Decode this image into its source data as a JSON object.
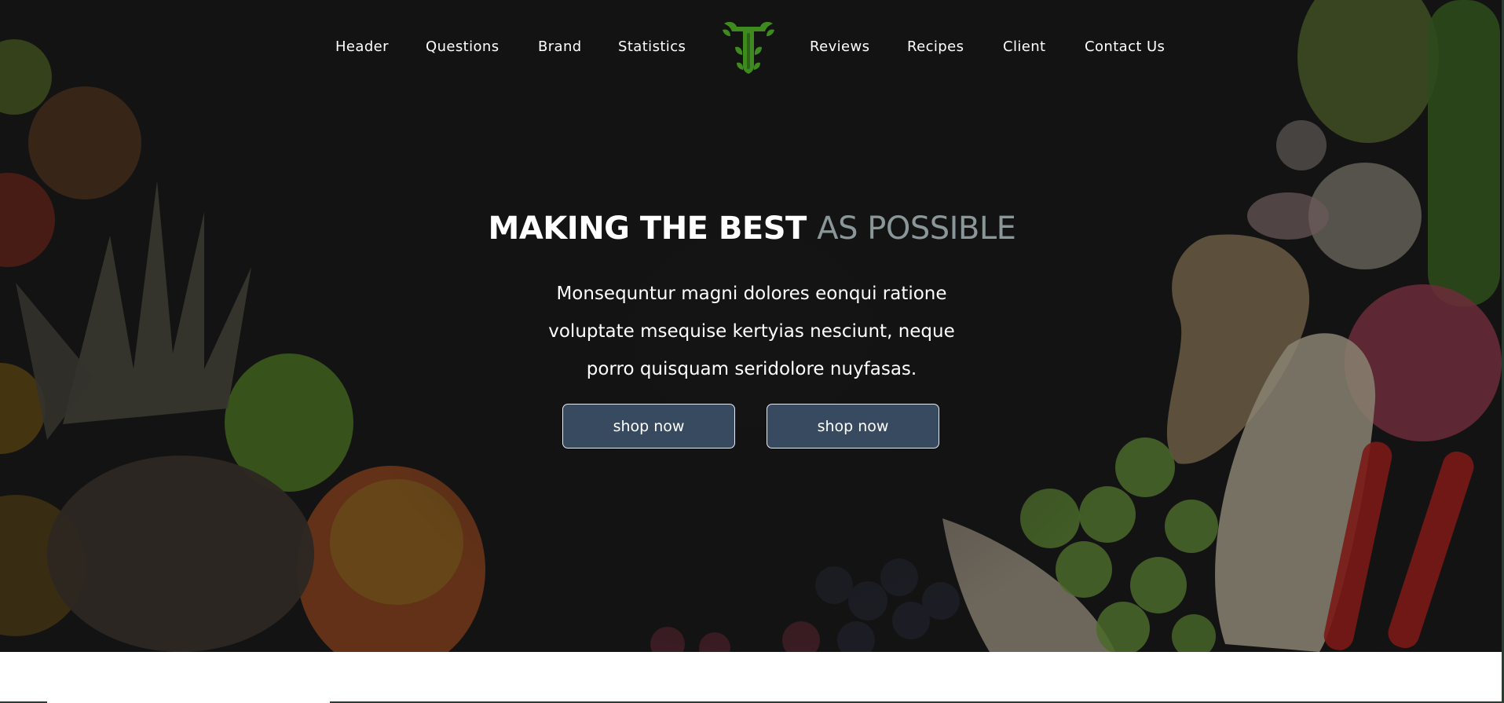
{
  "nav": {
    "left": [
      "Header",
      "Questions",
      "Brand",
      "Statistics"
    ],
    "right": [
      "Reviews",
      "Recipes",
      "Client",
      "Contact Us"
    ],
    "logo_icon": "tree-letter-t-logo-icon",
    "logo_color": "#3f8a1e"
  },
  "hero": {
    "title_strong": "MAKING THE BEST",
    "title_light": "AS POSSIBLE",
    "text_line_1": "Monsequntur magni dolores eonqui ratione",
    "text_line_2": "voluptate msequise kertyias nesciunt, neque",
    "text_line_3": "porro quisquam seridolore nuyfasas.",
    "button_1": "shop now",
    "button_2": "shop now",
    "background": "fruits-and-vegetables-dark-background"
  },
  "colors": {
    "hero_bg": "#131313",
    "title_light": "#8a9799",
    "button_bg": "#374a60",
    "button_border": "#e6ebf0"
  }
}
